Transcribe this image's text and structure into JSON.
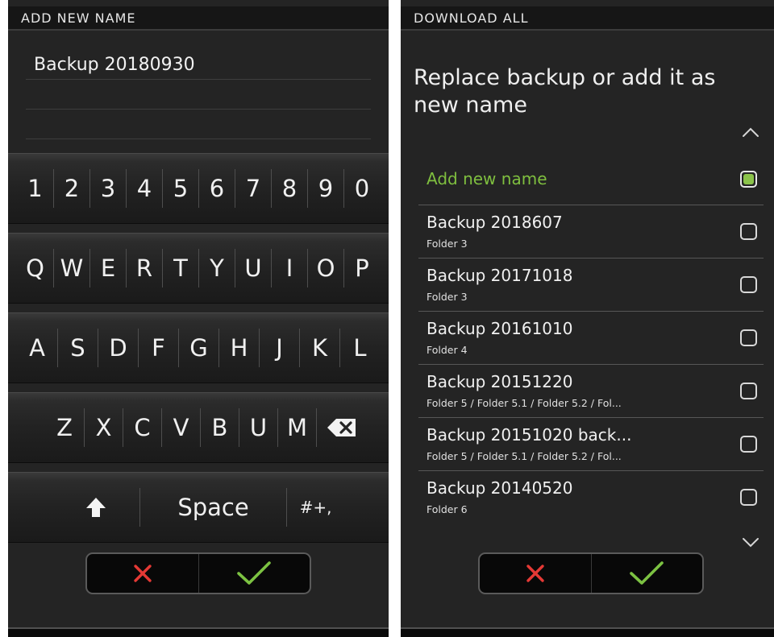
{
  "left": {
    "title": "ADD NEW NAME",
    "name_value": "Backup 20180930",
    "keyboard": {
      "row_numbers": [
        "1",
        "2",
        "3",
        "4",
        "5",
        "6",
        "7",
        "8",
        "9",
        "0"
      ],
      "row_qwerty": [
        "Q",
        "W",
        "E",
        "R",
        "T",
        "Y",
        "U",
        "I",
        "O",
        "P"
      ],
      "row_asdf": [
        "A",
        "S",
        "D",
        "F",
        "G",
        "H",
        "J",
        "K",
        "L"
      ],
      "row_zxcv": [
        "Z",
        "X",
        "C",
        "V",
        "B",
        "U",
        "M"
      ],
      "backspace_icon": "backspace-icon",
      "shift_icon": "shift-arrow-icon",
      "space_label": "Space",
      "symbols_label": "#+,"
    }
  },
  "right": {
    "title": "DOWNLOAD ALL",
    "heading": "Replace backup or add it as new name",
    "add_new_label": "Add new name",
    "items": [
      {
        "title": "Backup 2018607",
        "subtitle": "Folder 3"
      },
      {
        "title": "Backup 20171018",
        "subtitle": "Folder 3"
      },
      {
        "title": "Backup 20161010",
        "subtitle": "Folder 4"
      },
      {
        "title": "Backup 20151220",
        "subtitle": "Folder 5 / Folder 5.1 / Folder 5.2 / Fol..."
      },
      {
        "title": "Backup 20151020 back...",
        "subtitle": "Folder 5 / Folder 5.1 / Folder 5.2 / Fol..."
      },
      {
        "title": "Backup 20140520",
        "subtitle": "Folder 6"
      }
    ]
  },
  "icons": {
    "cancel": "cancel-x-icon",
    "confirm": "confirm-check-icon",
    "scroll_up": "chevron-up-icon",
    "scroll_down": "chevron-down-icon"
  },
  "colors": {
    "accent_green": "#8bc34a",
    "cancel_red": "#e53935",
    "confirm_green": "#7cc242",
    "background": "#242424",
    "selected_text": "#7fbf3f"
  }
}
